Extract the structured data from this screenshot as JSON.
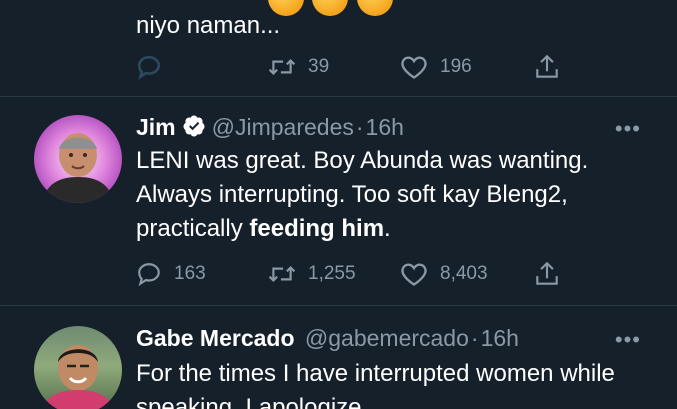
{
  "tweet_top": {
    "text_line": "niyo naman...",
    "actions": {
      "reply": "",
      "retweet": "39",
      "like": "196"
    }
  },
  "tweet_jim": {
    "name": "Jim",
    "handle": "@Jimparedes",
    "separator": "·",
    "time": "16h",
    "more": "•••",
    "text_before_bold": "LENI was great. Boy Abunda was wanting. Always interrupting. Too soft kay Bleng2, practically ",
    "text_bold": "feeding him",
    "text_after_bold": ".",
    "actions": {
      "reply": "163",
      "retweet": "1,255",
      "like": "8,403"
    }
  },
  "tweet_gabe": {
    "name": "Gabe Mercado",
    "handle": "@gabemercado",
    "separator": "·",
    "time": "16h",
    "more": "•••",
    "text": "For the times I have interrupted women while speaking, I apologize."
  },
  "colors": {
    "background": "#15202b",
    "muted": "#8b98a5",
    "verified": "#ffffff"
  }
}
